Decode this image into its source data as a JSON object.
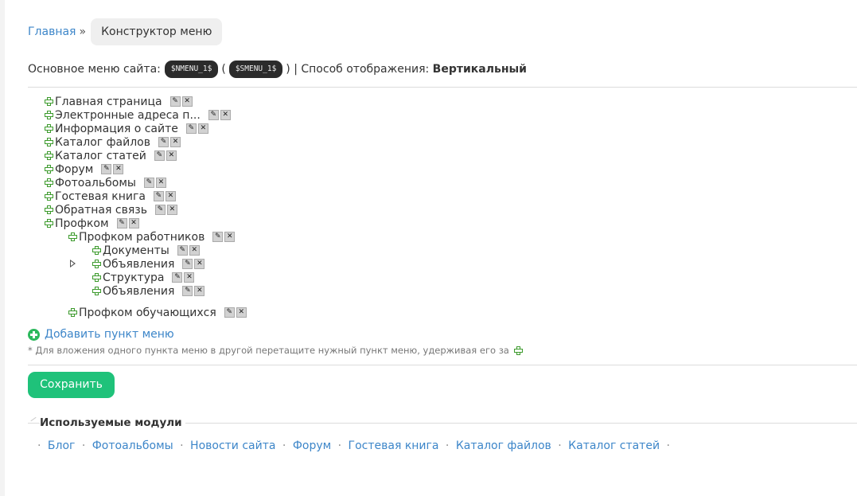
{
  "breadcrumb": {
    "home": "Главная",
    "separator": "»",
    "current": "Конструктор меню"
  },
  "info": {
    "prefix": "Основное меню сайта:",
    "code1": "$NMENU_1$",
    "open_paren": "(",
    "code2": "$SMENU_1$",
    "close_paren": ") | Способ отображения:",
    "mode": "Вертикальный"
  },
  "tree": {
    "items": [
      "Главная страница",
      "Электронные адреса п...",
      "Информация о сайте",
      "Каталог файлов",
      "Каталог статей",
      "Форум",
      "Фотоальбомы",
      "Гостевая книга",
      "Обратная связь",
      "Профком",
      "Профком работников",
      "Документы",
      "Объявления",
      "Структура",
      "Объявления",
      "Профком обучающихся"
    ],
    "edit_icon": "pencil-icon",
    "delete_icon": "close-icon"
  },
  "add_item": "Добавить пункт меню",
  "hint": "* Для вложения одного пункта меню в другой перетащите нужный пункт меню, удерживая его за",
  "save": "Сохранить",
  "modules": {
    "title": "Используемые модули",
    "links": [
      "Блог",
      "Фотоальбомы",
      "Новости сайта",
      "Форум",
      "Гостевая книга",
      "Каталог файлов",
      "Каталог статей"
    ],
    "separator": "·"
  },
  "colors": {
    "link": "#3d86c9",
    "accent": "#1fc27a",
    "plus": "#3c9a2c"
  }
}
